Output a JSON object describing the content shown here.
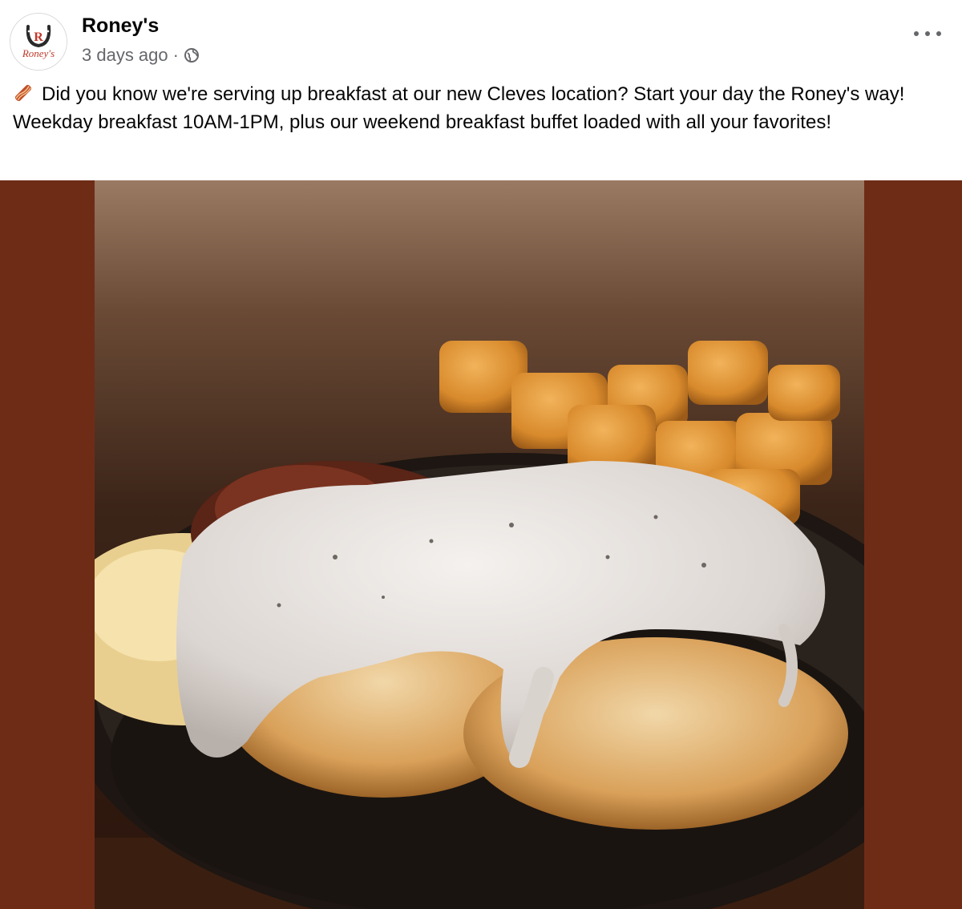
{
  "post": {
    "page_name": "Roney's",
    "timestamp": "3 days ago",
    "separator": "·",
    "audience_icon": "globe-icon",
    "more_icon": "more-options-icon",
    "caption": "Did you know we're serving up breakfast at our new Cleves location? Start your day the Roney's way! Weekday breakfast 10AM-1PM, plus our weekend breakfast buffet loaded with all your favorites!",
    "caption_emoji_icon": "bacon-icon",
    "avatar_logo_text": "Roney's",
    "photo_frame_color": "#6e2c17"
  }
}
